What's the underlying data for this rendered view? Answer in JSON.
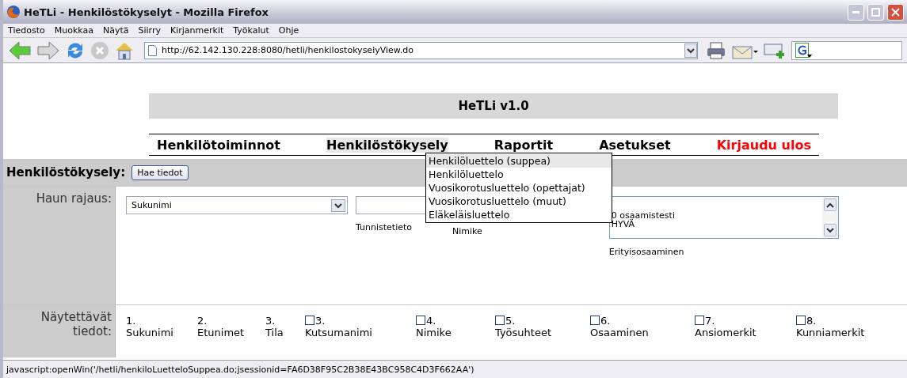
{
  "window": {
    "title": "HeTLi - Henkilöstökyselyt - Mozilla Firefox"
  },
  "menu": [
    "Tiedosto",
    "Muokkaa",
    "Näytä",
    "Siirry",
    "Kirjanmerkit",
    "Työkalut",
    "Ohje"
  ],
  "address": {
    "value": "http://62.142.130.228:8080/hetli/henkilostokyselyView.do"
  },
  "app_title": "HeTLi v1.0",
  "nav": [
    {
      "label": "Henkilötoiminnot",
      "selected": false,
      "kind": "link"
    },
    {
      "label": "Henkilöstökysely",
      "selected": true,
      "kind": "link"
    },
    {
      "label": "Raportit",
      "selected": false,
      "kind": "link"
    },
    {
      "label": "Asetukset",
      "selected": false,
      "kind": "link"
    },
    {
      "label": "Kirjaudu ulos",
      "selected": false,
      "kind": "logout"
    }
  ],
  "report_menu": [
    {
      "label": "Henkilöluettelo (suppea)",
      "selected": true
    },
    {
      "label": "Henkilöluettelo",
      "selected": false
    },
    {
      "label": "Vuosikorotusluettelo (opettajat)",
      "selected": false
    },
    {
      "label": "Vuosikorotusluettelo (muut)",
      "selected": false
    },
    {
      "label": "Eläkeläisluettelo",
      "selected": false
    }
  ],
  "section": {
    "title": "Henkilöstökysely:",
    "button": "Hae tiedot"
  },
  "filter": {
    "label": "Haun rajaus:",
    "select": "Sukunimi",
    "id_label": "Tunnistetieto",
    "title_label": "Nimike",
    "skills": [
      "0 osaamistesti",
      "HYVÄ"
    ],
    "skills_label": "Erityisosaaminen"
  },
  "shown": {
    "label": "Näytettävät tiedot:",
    "fields": [
      {
        "kind": "fixed",
        "number": "1.",
        "label": "Sukunimi"
      },
      {
        "kind": "fixed",
        "number": "2.",
        "label": "Etunimet"
      },
      {
        "kind": "fixed",
        "number": "3.",
        "label": "Tila"
      },
      {
        "kind": "checkbox",
        "checked": false,
        "number": "3.",
        "label": "Kutsumanimi"
      },
      {
        "kind": "checkbox",
        "checked": false,
        "number": "4.",
        "label": "Nimike"
      },
      {
        "kind": "checkbox",
        "checked": false,
        "number": "5.",
        "label": "Työsuhteet"
      },
      {
        "kind": "checkbox",
        "checked": false,
        "number": "6.",
        "label": "Osaaminen"
      },
      {
        "kind": "checkbox",
        "checked": false,
        "number": "7.",
        "label": "Ansiomerkit"
      },
      {
        "kind": "checkbox",
        "checked": false,
        "number": "8.",
        "label": "Kunniamerkit"
      }
    ]
  },
  "status_bar": "javascript:openWin('/hetli/henkiloLuetteloSuppea.do;jsessionid=FA6D38F95C2B38E43BC958C4D3F662AA')"
}
